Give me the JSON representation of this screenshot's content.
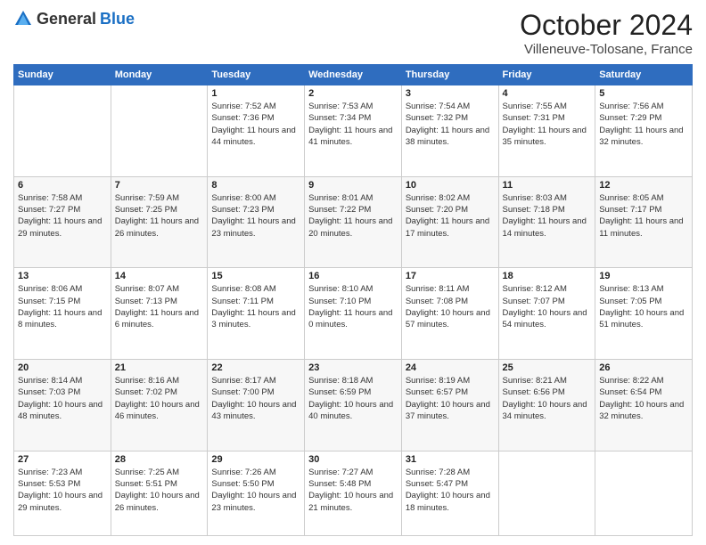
{
  "header": {
    "logo_general": "General",
    "logo_blue": "Blue",
    "month_title": "October 2024",
    "location": "Villeneuve-Tolosane, France"
  },
  "weekdays": [
    "Sunday",
    "Monday",
    "Tuesday",
    "Wednesday",
    "Thursday",
    "Friday",
    "Saturday"
  ],
  "weeks": [
    [
      {
        "day": "",
        "sunrise": "",
        "sunset": "",
        "daylight": ""
      },
      {
        "day": "",
        "sunrise": "",
        "sunset": "",
        "daylight": ""
      },
      {
        "day": "1",
        "sunrise": "Sunrise: 7:52 AM",
        "sunset": "Sunset: 7:36 PM",
        "daylight": "Daylight: 11 hours and 44 minutes."
      },
      {
        "day": "2",
        "sunrise": "Sunrise: 7:53 AM",
        "sunset": "Sunset: 7:34 PM",
        "daylight": "Daylight: 11 hours and 41 minutes."
      },
      {
        "day": "3",
        "sunrise": "Sunrise: 7:54 AM",
        "sunset": "Sunset: 7:32 PM",
        "daylight": "Daylight: 11 hours and 38 minutes."
      },
      {
        "day": "4",
        "sunrise": "Sunrise: 7:55 AM",
        "sunset": "Sunset: 7:31 PM",
        "daylight": "Daylight: 11 hours and 35 minutes."
      },
      {
        "day": "5",
        "sunrise": "Sunrise: 7:56 AM",
        "sunset": "Sunset: 7:29 PM",
        "daylight": "Daylight: 11 hours and 32 minutes."
      }
    ],
    [
      {
        "day": "6",
        "sunrise": "Sunrise: 7:58 AM",
        "sunset": "Sunset: 7:27 PM",
        "daylight": "Daylight: 11 hours and 29 minutes."
      },
      {
        "day": "7",
        "sunrise": "Sunrise: 7:59 AM",
        "sunset": "Sunset: 7:25 PM",
        "daylight": "Daylight: 11 hours and 26 minutes."
      },
      {
        "day": "8",
        "sunrise": "Sunrise: 8:00 AM",
        "sunset": "Sunset: 7:23 PM",
        "daylight": "Daylight: 11 hours and 23 minutes."
      },
      {
        "day": "9",
        "sunrise": "Sunrise: 8:01 AM",
        "sunset": "Sunset: 7:22 PM",
        "daylight": "Daylight: 11 hours and 20 minutes."
      },
      {
        "day": "10",
        "sunrise": "Sunrise: 8:02 AM",
        "sunset": "Sunset: 7:20 PM",
        "daylight": "Daylight: 11 hours and 17 minutes."
      },
      {
        "day": "11",
        "sunrise": "Sunrise: 8:03 AM",
        "sunset": "Sunset: 7:18 PM",
        "daylight": "Daylight: 11 hours and 14 minutes."
      },
      {
        "day": "12",
        "sunrise": "Sunrise: 8:05 AM",
        "sunset": "Sunset: 7:17 PM",
        "daylight": "Daylight: 11 hours and 11 minutes."
      }
    ],
    [
      {
        "day": "13",
        "sunrise": "Sunrise: 8:06 AM",
        "sunset": "Sunset: 7:15 PM",
        "daylight": "Daylight: 11 hours and 8 minutes."
      },
      {
        "day": "14",
        "sunrise": "Sunrise: 8:07 AM",
        "sunset": "Sunset: 7:13 PM",
        "daylight": "Daylight: 11 hours and 6 minutes."
      },
      {
        "day": "15",
        "sunrise": "Sunrise: 8:08 AM",
        "sunset": "Sunset: 7:11 PM",
        "daylight": "Daylight: 11 hours and 3 minutes."
      },
      {
        "day": "16",
        "sunrise": "Sunrise: 8:10 AM",
        "sunset": "Sunset: 7:10 PM",
        "daylight": "Daylight: 11 hours and 0 minutes."
      },
      {
        "day": "17",
        "sunrise": "Sunrise: 8:11 AM",
        "sunset": "Sunset: 7:08 PM",
        "daylight": "Daylight: 10 hours and 57 minutes."
      },
      {
        "day": "18",
        "sunrise": "Sunrise: 8:12 AM",
        "sunset": "Sunset: 7:07 PM",
        "daylight": "Daylight: 10 hours and 54 minutes."
      },
      {
        "day": "19",
        "sunrise": "Sunrise: 8:13 AM",
        "sunset": "Sunset: 7:05 PM",
        "daylight": "Daylight: 10 hours and 51 minutes."
      }
    ],
    [
      {
        "day": "20",
        "sunrise": "Sunrise: 8:14 AM",
        "sunset": "Sunset: 7:03 PM",
        "daylight": "Daylight: 10 hours and 48 minutes."
      },
      {
        "day": "21",
        "sunrise": "Sunrise: 8:16 AM",
        "sunset": "Sunset: 7:02 PM",
        "daylight": "Daylight: 10 hours and 46 minutes."
      },
      {
        "day": "22",
        "sunrise": "Sunrise: 8:17 AM",
        "sunset": "Sunset: 7:00 PM",
        "daylight": "Daylight: 10 hours and 43 minutes."
      },
      {
        "day": "23",
        "sunrise": "Sunrise: 8:18 AM",
        "sunset": "Sunset: 6:59 PM",
        "daylight": "Daylight: 10 hours and 40 minutes."
      },
      {
        "day": "24",
        "sunrise": "Sunrise: 8:19 AM",
        "sunset": "Sunset: 6:57 PM",
        "daylight": "Daylight: 10 hours and 37 minutes."
      },
      {
        "day": "25",
        "sunrise": "Sunrise: 8:21 AM",
        "sunset": "Sunset: 6:56 PM",
        "daylight": "Daylight: 10 hours and 34 minutes."
      },
      {
        "day": "26",
        "sunrise": "Sunrise: 8:22 AM",
        "sunset": "Sunset: 6:54 PM",
        "daylight": "Daylight: 10 hours and 32 minutes."
      }
    ],
    [
      {
        "day": "27",
        "sunrise": "Sunrise: 7:23 AM",
        "sunset": "Sunset: 5:53 PM",
        "daylight": "Daylight: 10 hours and 29 minutes."
      },
      {
        "day": "28",
        "sunrise": "Sunrise: 7:25 AM",
        "sunset": "Sunset: 5:51 PM",
        "daylight": "Daylight: 10 hours and 26 minutes."
      },
      {
        "day": "29",
        "sunrise": "Sunrise: 7:26 AM",
        "sunset": "Sunset: 5:50 PM",
        "daylight": "Daylight: 10 hours and 23 minutes."
      },
      {
        "day": "30",
        "sunrise": "Sunrise: 7:27 AM",
        "sunset": "Sunset: 5:48 PM",
        "daylight": "Daylight: 10 hours and 21 minutes."
      },
      {
        "day": "31",
        "sunrise": "Sunrise: 7:28 AM",
        "sunset": "Sunset: 5:47 PM",
        "daylight": "Daylight: 10 hours and 18 minutes."
      },
      {
        "day": "",
        "sunrise": "",
        "sunset": "",
        "daylight": ""
      },
      {
        "day": "",
        "sunrise": "",
        "sunset": "",
        "daylight": ""
      }
    ]
  ]
}
